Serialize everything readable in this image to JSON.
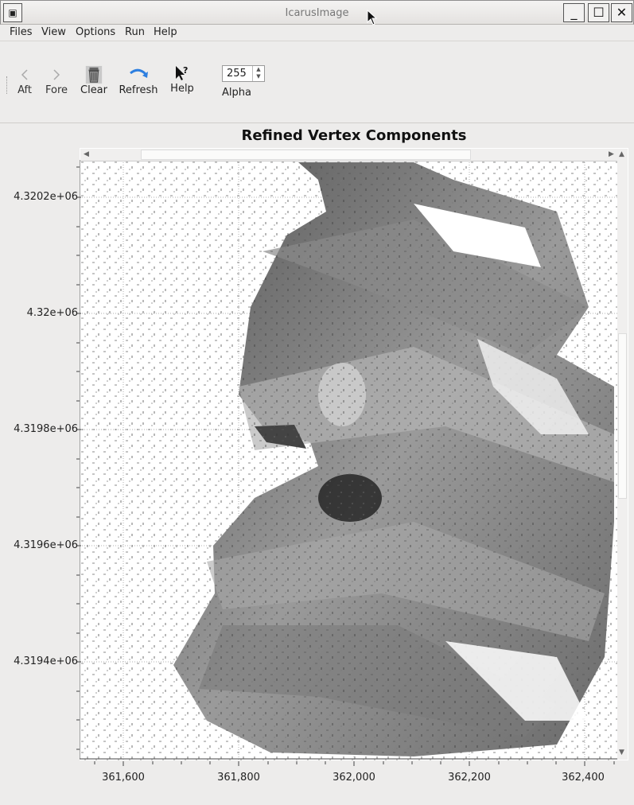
{
  "window": {
    "title": "IcarusImage",
    "sysmenu_glyph": "▣",
    "min_glyph": "_",
    "max_glyph": "☐",
    "close_glyph": "✕"
  },
  "menubar": [
    {
      "label": "Files"
    },
    {
      "label": "View"
    },
    {
      "label": "Options"
    },
    {
      "label": "Run"
    },
    {
      "label": "Help"
    }
  ],
  "toolbar": {
    "aft_label": "Aft",
    "fore_label": "Fore",
    "clear_label": "Clear",
    "refresh_label": "Refresh",
    "help_label": "Help",
    "alpha_value": "255",
    "alpha_label": "Alpha"
  },
  "plot": {
    "title": "Refined Vertex Components",
    "y_ticks": [
      "4.3202e+06",
      "4.32e+06",
      "4.3198e+06",
      "4.3196e+06",
      "4.3194e+06"
    ],
    "x_ticks": [
      "361,600",
      "361,800",
      "362,000",
      "362,200",
      "362,400"
    ]
  },
  "colors": {
    "accent_refresh": "#2d7fe0",
    "grid": "#b0b0b0"
  }
}
